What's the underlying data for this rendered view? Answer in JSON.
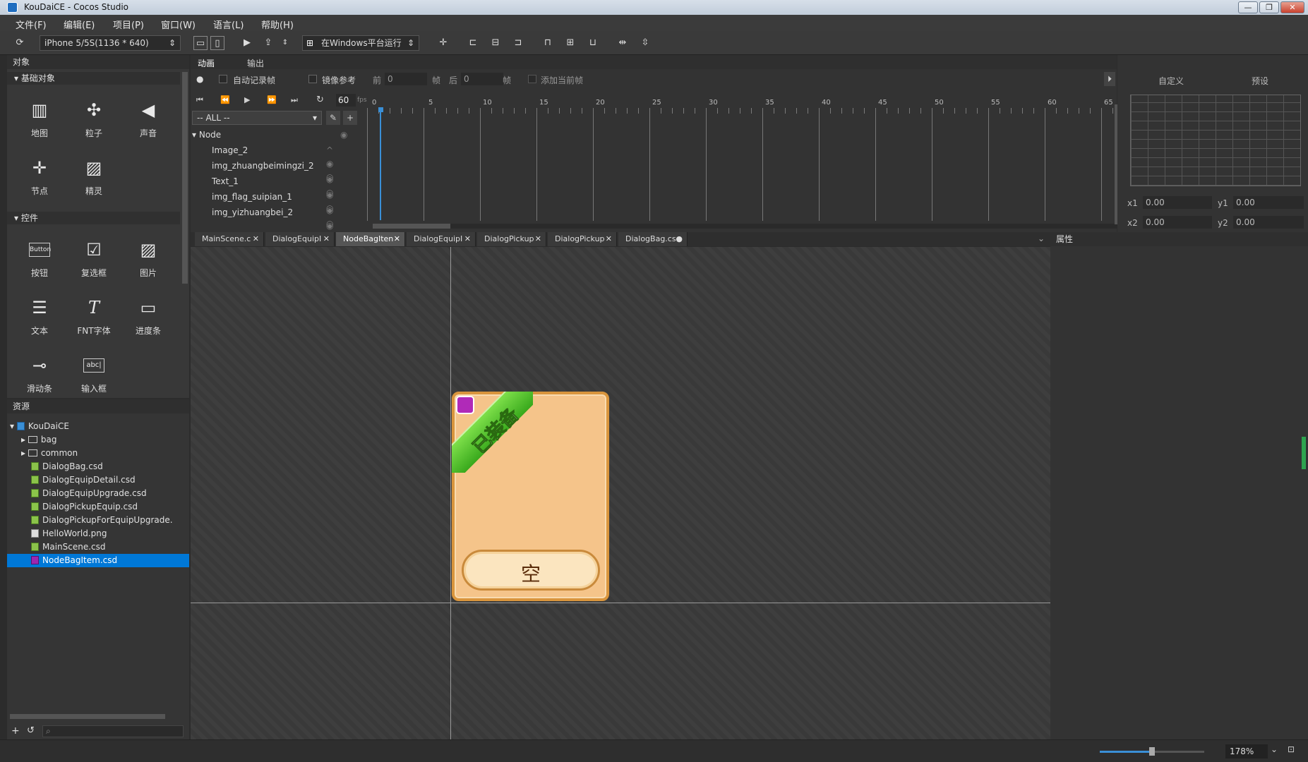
{
  "app": {
    "title": "KouDaiCE - Cocos Studio"
  },
  "menu": [
    "文件(F)",
    "编辑(E)",
    "项目(P)",
    "窗口(W)",
    "语言(L)",
    "帮助(H)"
  ],
  "toolbar": {
    "device": "iPhone 5/5S(1136 * 640)",
    "run_target": "在Windows平台运行"
  },
  "objects_panel": {
    "title": "对象",
    "basic_section": "基础对象",
    "controls_section": "控件",
    "basic_items": [
      {
        "label": "地图",
        "icon": "map-icon"
      },
      {
        "label": "粒子",
        "icon": "particle-icon"
      },
      {
        "label": "声音",
        "icon": "sound-icon"
      },
      {
        "label": "节点",
        "icon": "node-icon"
      },
      {
        "label": "精灵",
        "icon": "sprite-icon"
      }
    ],
    "control_items": [
      {
        "label": "按钮",
        "icon": "button-icon"
      },
      {
        "label": "复选框",
        "icon": "checkbox-icon"
      },
      {
        "label": "图片",
        "icon": "image-icon"
      },
      {
        "label": "文本",
        "icon": "text-icon"
      },
      {
        "label": "FNT字体",
        "icon": "fnt-icon"
      },
      {
        "label": "进度条",
        "icon": "progressbar-icon"
      },
      {
        "label": "滑动条",
        "icon": "slider-icon"
      },
      {
        "label": "输入框",
        "icon": "textfield-icon"
      }
    ]
  },
  "resources_panel": {
    "title": "资源",
    "root": "KouDaiCE",
    "items": [
      {
        "name": "bag",
        "type": "folder"
      },
      {
        "name": "common",
        "type": "folder"
      },
      {
        "name": "DialogBag.csd",
        "type": "csd"
      },
      {
        "name": "DialogEquipDetail.csd",
        "type": "csd"
      },
      {
        "name": "DialogEquipUpgrade.csd",
        "type": "csd"
      },
      {
        "name": "DialogPickupEquip.csd",
        "type": "csd"
      },
      {
        "name": "DialogPickupForEquipUpgrade.",
        "type": "csd"
      },
      {
        "name": "HelloWorld.png",
        "type": "png"
      },
      {
        "name": "MainScene.csd",
        "type": "csd"
      },
      {
        "name": "NodeBagItem.csd",
        "type": "csd",
        "selected": true
      }
    ]
  },
  "animation_panel": {
    "tabs": [
      "动画",
      "输出"
    ],
    "auto_record": "自动记录帧",
    "mirror": "镜像参考",
    "prev_label": "前",
    "prev_value": "0",
    "frame_unit": "帧",
    "next_label": "后",
    "next_value": "0",
    "add_current": "添加当前帧",
    "fps": "60",
    "fps_unit": "fps",
    "filter": "-- ALL --",
    "root_node": "Node",
    "nodes": [
      "Image_2",
      "img_zhuangbeimingzi_2",
      "Text_1",
      "img_flag_suipian_1",
      "img_yizhuangbei_2"
    ],
    "ticks": [
      "0",
      "5",
      "10",
      "15",
      "20",
      "25",
      "30",
      "35",
      "40",
      "45",
      "50",
      "55",
      "60",
      "65"
    ]
  },
  "curve_panel": {
    "tab_custom": "自定义",
    "tab_preset": "预设",
    "x1_label": "x1",
    "x1": "0.00",
    "y1_label": "y1",
    "y1": "0.00",
    "x2_label": "x2",
    "x2": "0.00",
    "y2_label": "y2",
    "y2": "0.00"
  },
  "doc_tabs": [
    {
      "label": "MainScene.c"
    },
    {
      "label": "DialogEquipI"
    },
    {
      "label": "NodeBagIten",
      "active": true
    },
    {
      "label": "DialogEquipI"
    },
    {
      "label": "DialogPickup"
    },
    {
      "label": "DialogPickup"
    },
    {
      "label": "DialogBag.cs"
    }
  ],
  "canvas": {
    "badge_text": "已装备",
    "slot_text": "空"
  },
  "properties_panel": {
    "title": "属性"
  },
  "status": {
    "zoom": "178%"
  }
}
